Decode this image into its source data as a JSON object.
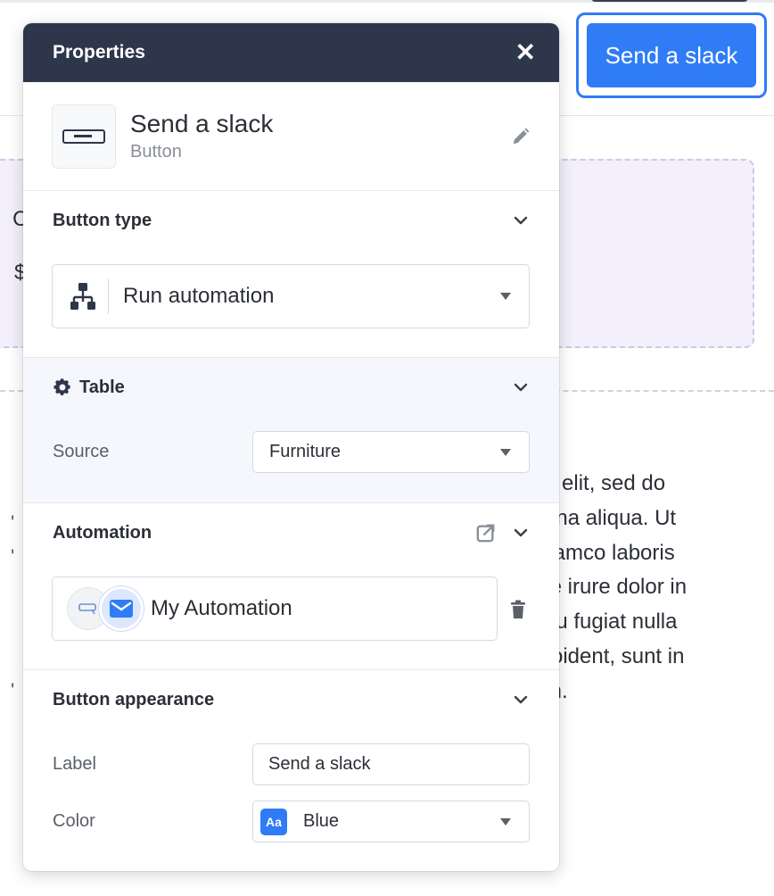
{
  "canvas": {
    "button_label": "Send a slack",
    "purple_glyphs": [
      "C",
      "$"
    ],
    "lorem_lines": [
      "g elit, sed do",
      "gna aliqua. Ut",
      "llamco laboris",
      "te irure dolor in",
      "eu fugiat nulla",
      "roident, sunt in",
      "m."
    ]
  },
  "panel": {
    "title": "Properties",
    "close_glyph": "✕",
    "component": {
      "name": "Send a slack",
      "type": "Button"
    },
    "button_type": {
      "title": "Button type",
      "value": "Run automation"
    },
    "table": {
      "title": "Table",
      "source_label": "Source",
      "source_value": "Furniture"
    },
    "automation": {
      "title": "Automation",
      "name": "My Automation"
    },
    "appearance": {
      "title": "Button appearance",
      "label_label": "Label",
      "label_value": "Send a slack",
      "color_label": "Color",
      "color_badge": "Aa",
      "color_value": "Blue"
    }
  },
  "colors": {
    "header": "#2d364a",
    "accent": "#2f7cf6",
    "table_bg": "#f5f7fd",
    "card_bg": "#f3f0fb"
  }
}
